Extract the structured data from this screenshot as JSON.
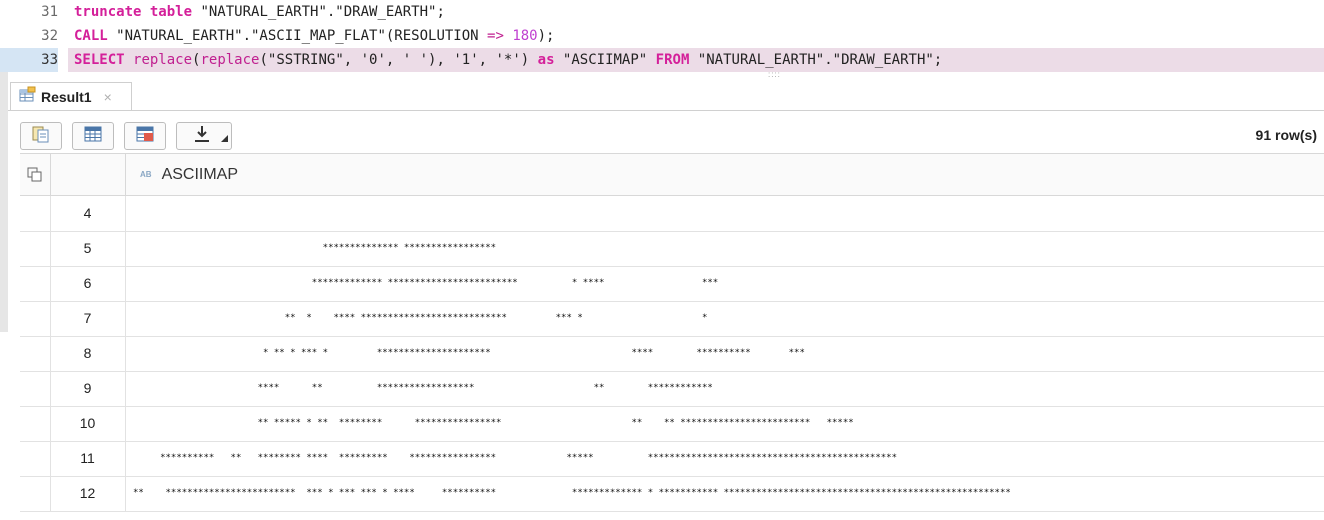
{
  "editor": {
    "lines": [
      {
        "number": "31",
        "parts": [
          {
            "t": "truncate table",
            "c": "kw"
          },
          {
            "t": " \"NATURAL_EARTH\".\"DRAW_EARTH\";",
            "c": "str"
          }
        ]
      },
      {
        "number": "32",
        "parts": [
          {
            "t": "CALL",
            "c": "kw"
          },
          {
            "t": " \"NATURAL_EARTH\".\"ASCII_MAP_FLAT\"(RESOLUTION ",
            "c": "str"
          },
          {
            "t": "=>",
            "c": "op"
          },
          {
            "t": " ",
            "c": "str"
          },
          {
            "t": "180",
            "c": "num"
          },
          {
            "t": ");",
            "c": "str"
          }
        ]
      },
      {
        "number": "33",
        "active": true,
        "parts": [
          {
            "t": "SELECT",
            "c": "kw"
          },
          {
            "t": " ",
            "c": "str"
          },
          {
            "t": "replace",
            "c": "fn"
          },
          {
            "t": "(",
            "c": "str"
          },
          {
            "t": "replace",
            "c": "fn"
          },
          {
            "t": "(\"SSTRING\", '0', ' '), '1', '*') ",
            "c": "str"
          },
          {
            "t": "as",
            "c": "kw"
          },
          {
            "t": " \"ASCIIMAP\" ",
            "c": "str"
          },
          {
            "t": "FROM",
            "c": "kw"
          },
          {
            "t": " \"NATURAL_EARTH\".\"DRAW_EARTH\";",
            "c": "str"
          }
        ]
      }
    ]
  },
  "result_tab": {
    "label": "Result1",
    "close": "×"
  },
  "toolbar": {
    "icons": [
      "copy-icon",
      "grid-icon",
      "table-icon",
      "download-icon"
    ]
  },
  "row_count": "91 row(s)",
  "grid": {
    "column_header": "ASCIIMAP",
    "column_type_badge": "AB",
    "rows": [
      {
        "num": "4",
        "value": ""
      },
      {
        "num": "5",
        "value": "                                   ************** *****************"
      },
      {
        "num": "6",
        "value": "                                 ************* ************************          * ****                  ***"
      },
      {
        "num": "7",
        "value": "                            **  *    **** ***************************         *** *                      *"
      },
      {
        "num": "8",
        "value": "                        * ** * *** *         *********************                          ****        **********       ***"
      },
      {
        "num": "9",
        "value": "                       ****      **          ******************                      **        ************"
      },
      {
        "num": "10",
        "value": "                       ** ***** * **  ********      ****************                        **    ** ************************   *****"
      },
      {
        "num": "11",
        "value": "     **********   **   ******** ****  *********    ****************             *****          **********************************************"
      },
      {
        "num": "12",
        "value": "**    ************************  *** * *** *** * ****     **********              ************* * *********** *****************************************************"
      }
    ]
  }
}
